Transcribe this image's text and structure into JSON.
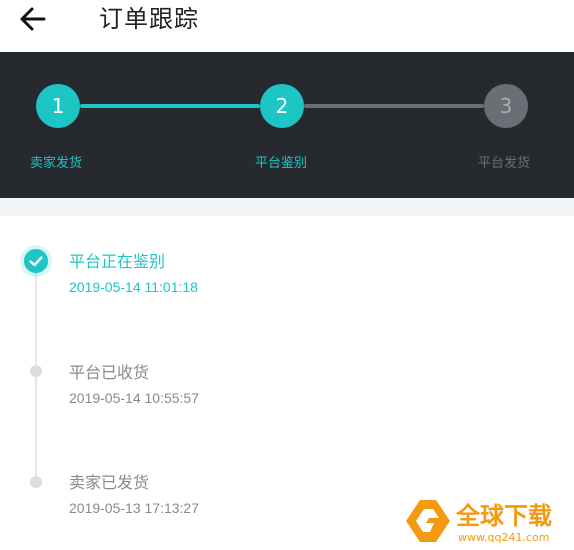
{
  "header": {
    "title": "订单跟踪",
    "back_icon": "arrow-left-icon"
  },
  "colors": {
    "accent": "#1dc5c5",
    "stepper_bg": "#262a2e",
    "inactive_step": "#6b6e75",
    "muted_text": "#8a8a8f"
  },
  "steps": [
    {
      "number": "1",
      "label": "卖家发货",
      "state": "done"
    },
    {
      "number": "2",
      "label": "平台鉴别",
      "state": "current"
    },
    {
      "number": "3",
      "label": "平台发货",
      "state": "pending"
    }
  ],
  "timeline": [
    {
      "status": "平台正在鉴别",
      "time": "2019-05-14 11:01:18",
      "active": true
    },
    {
      "status": "平台已收货",
      "time": "2019-05-14 10:55:57",
      "active": false
    },
    {
      "status": "卖家已发货",
      "time": "2019-05-13 17:13:27",
      "active": false
    }
  ],
  "watermark": {
    "text": "全球下载",
    "url": "www.qq241.com"
  }
}
